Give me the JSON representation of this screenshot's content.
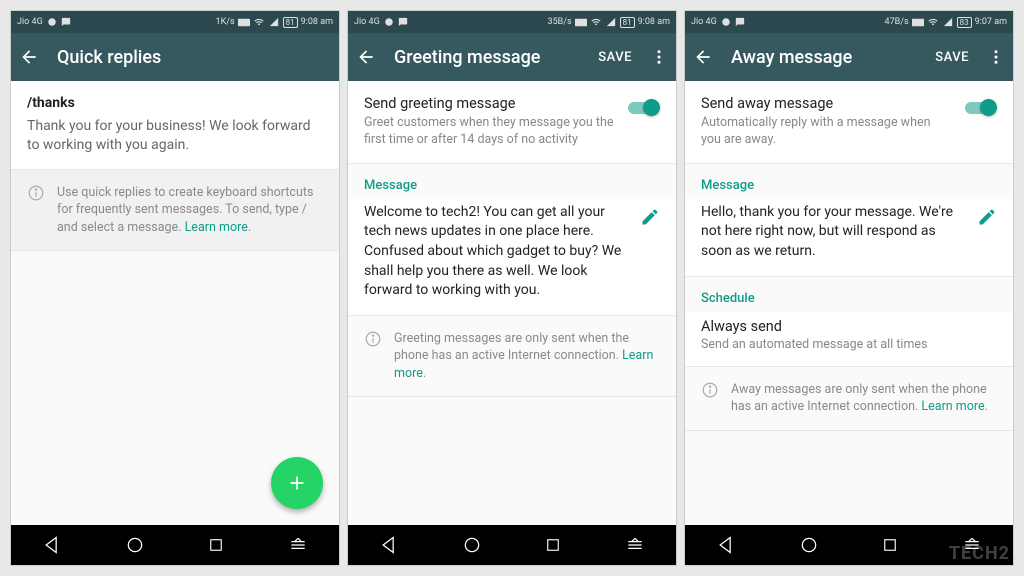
{
  "watermark": "TECH2",
  "screens": [
    {
      "status": {
        "carrier": "Jio 4G",
        "rate": "1K/s",
        "battery": "81",
        "time": "9:08 am"
      },
      "title": "Quick replies",
      "has_save": false,
      "has_more": false,
      "quick_reply": {
        "shortcut": "/thanks",
        "body": "Thank you for your business! We look forward to working with you again."
      },
      "hint": {
        "text": "Use quick replies to create keyboard shortcuts for frequently sent messages. To send, type / and select a message. ",
        "link": "Learn more"
      },
      "has_fab": true
    },
    {
      "status": {
        "carrier": "Jio 4G",
        "rate": "35B/s",
        "battery": "81",
        "time": "9:08 am"
      },
      "title": "Greeting message",
      "has_save": true,
      "has_more": true,
      "save": "SAVE",
      "toggle": {
        "title": "Send greeting message",
        "desc": "Greet customers when they message you the first time or after 14 days of no activity"
      },
      "message_label": "Message",
      "message_text": "Welcome to tech2! You can get all your tech news updates in one place here. Confused about which gadget to buy? We shall help you there as well. We look forward to working with you.",
      "hint": {
        "text": "Greeting messages are only sent when the phone has an active Internet connection. ",
        "link": "Learn more"
      }
    },
    {
      "status": {
        "carrier": "Jio 4G",
        "rate": "47B/s",
        "battery": "83",
        "time": "9:07 am"
      },
      "title": "Away message",
      "has_save": true,
      "has_more": true,
      "save": "SAVE",
      "toggle": {
        "title": "Send away message",
        "desc": "Automatically reply with a message when you are away."
      },
      "message_label": "Message",
      "message_text": "Hello, thank you for your message. We're not here right now, but will respond as soon as we return.",
      "schedule_label": "Schedule",
      "schedule": {
        "title": "Always send",
        "desc": "Send an automated message at all times"
      },
      "hint": {
        "text": "Away messages are only sent when the phone has an active Internet connection. ",
        "link": "Learn more"
      }
    }
  ]
}
